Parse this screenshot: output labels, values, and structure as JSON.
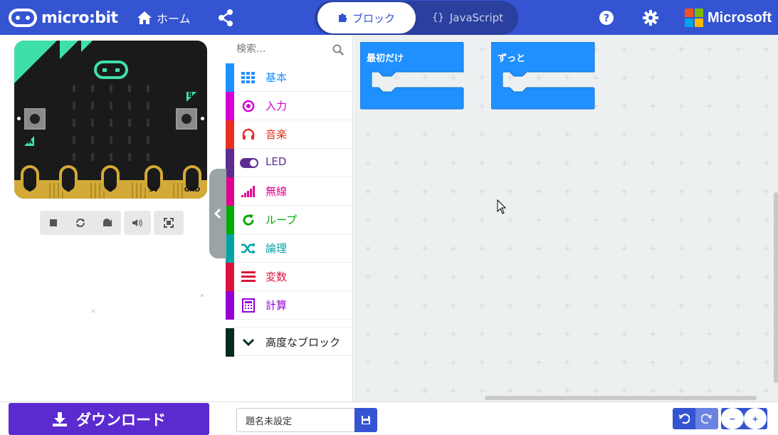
{
  "header": {
    "brand": "micro:bit",
    "home_label": "ホーム",
    "mode_blocks_label": "ブロック",
    "mode_js_label": "JavaScript",
    "ms_label": "Microsoft"
  },
  "simulator": {
    "pins": [
      "0",
      "1",
      "2",
      "3V",
      "GND"
    ],
    "button_a_label": "A",
    "button_b_label": "B"
  },
  "toolbox": {
    "search_placeholder": "検索...",
    "categories": [
      {
        "label": "基本",
        "color": "#1e90ff",
        "icon": "grid-icon"
      },
      {
        "label": "入力",
        "color": "#d400d4",
        "icon": "target-icon"
      },
      {
        "label": "音楽",
        "color": "#e63022",
        "icon": "headphones-icon"
      },
      {
        "label": "LED",
        "color": "#5c2d91",
        "icon": "toggle-icon"
      },
      {
        "label": "無線",
        "color": "#e3008c",
        "icon": "signal-bars-icon"
      },
      {
        "label": "ループ",
        "color": "#00aa00",
        "icon": "refresh-icon"
      },
      {
        "label": "論理",
        "color": "#00a4a6",
        "icon": "shuffle-icon"
      },
      {
        "label": "変数",
        "color": "#dc143c",
        "icon": "lines-icon"
      },
      {
        "label": "計算",
        "color": "#9400d3",
        "icon": "calculator-icon"
      }
    ],
    "advanced": {
      "label": "高度なブロック",
      "color": "#042b21"
    }
  },
  "workspace": {
    "blocks": [
      {
        "label": "最初だけ",
        "color": "#1e90ff"
      },
      {
        "label": "ずっと",
        "color": "#1e90ff"
      }
    ]
  },
  "bottom": {
    "download_label": "ダウンロード",
    "project_name": "題名未設定"
  }
}
